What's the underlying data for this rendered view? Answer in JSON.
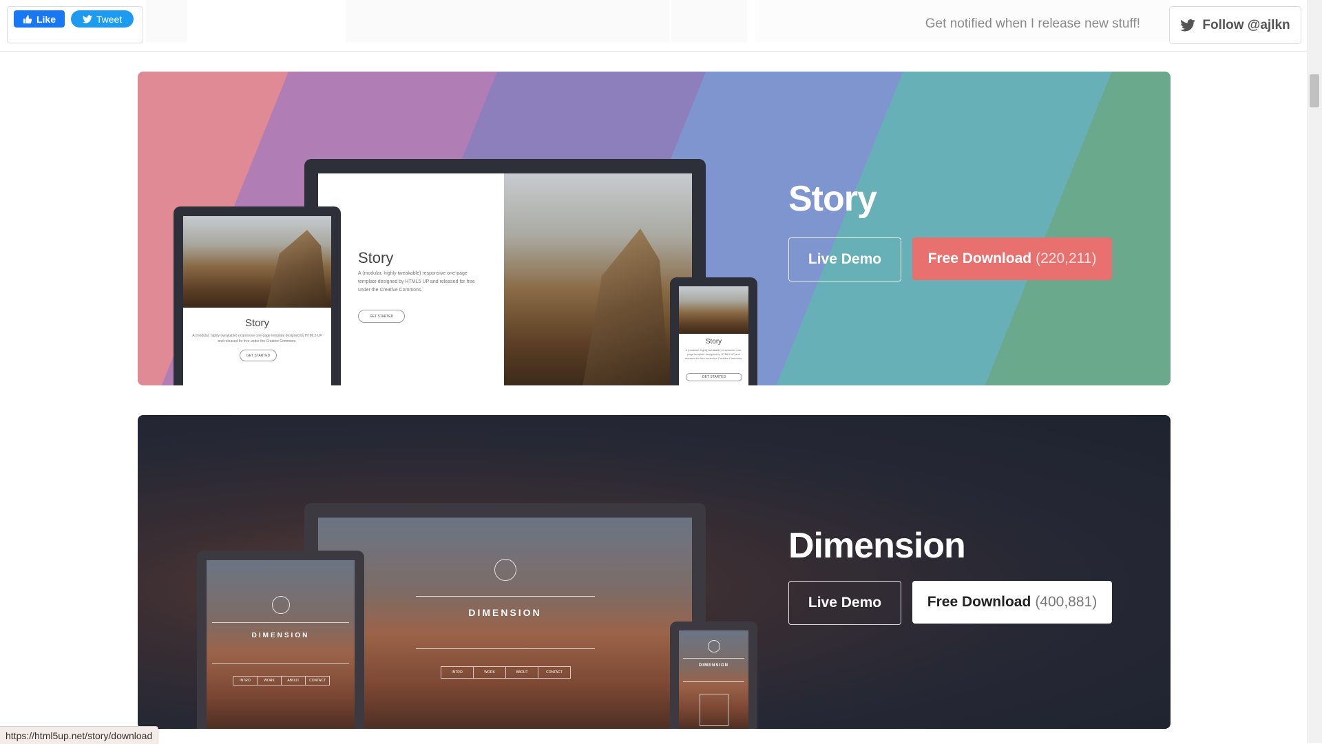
{
  "topbar": {
    "like_label": "Like",
    "tweet_label": "Tweet",
    "notify_text": "Get notified when I release new stuff!",
    "follow_label": "Follow @ajlkn"
  },
  "templates": [
    {
      "name": "Story",
      "live_demo_label": "Live Demo",
      "download_label": "Free Download",
      "download_count": "(220,211)",
      "mock_title": "Story",
      "mock_text": "A (modular, highly tweakable) responsive one-page template designed by HTML5 UP and released for free under the Creative Commons.",
      "mock_button": "GET STARTED"
    },
    {
      "name": "Dimension",
      "live_demo_label": "Live Demo",
      "download_label": "Free Download",
      "download_count": "(400,881)",
      "mock_title": "DIMENSION",
      "mock_nav": [
        "INTRO",
        "WORK",
        "ABOUT",
        "CONTACT"
      ]
    }
  ],
  "statusbar": {
    "url": "https://html5up.net/story/download"
  },
  "colors": {
    "story_download_bg": "#e8706f",
    "facebook_blue": "#1877f2",
    "twitter_blue": "#1d9bf0"
  }
}
